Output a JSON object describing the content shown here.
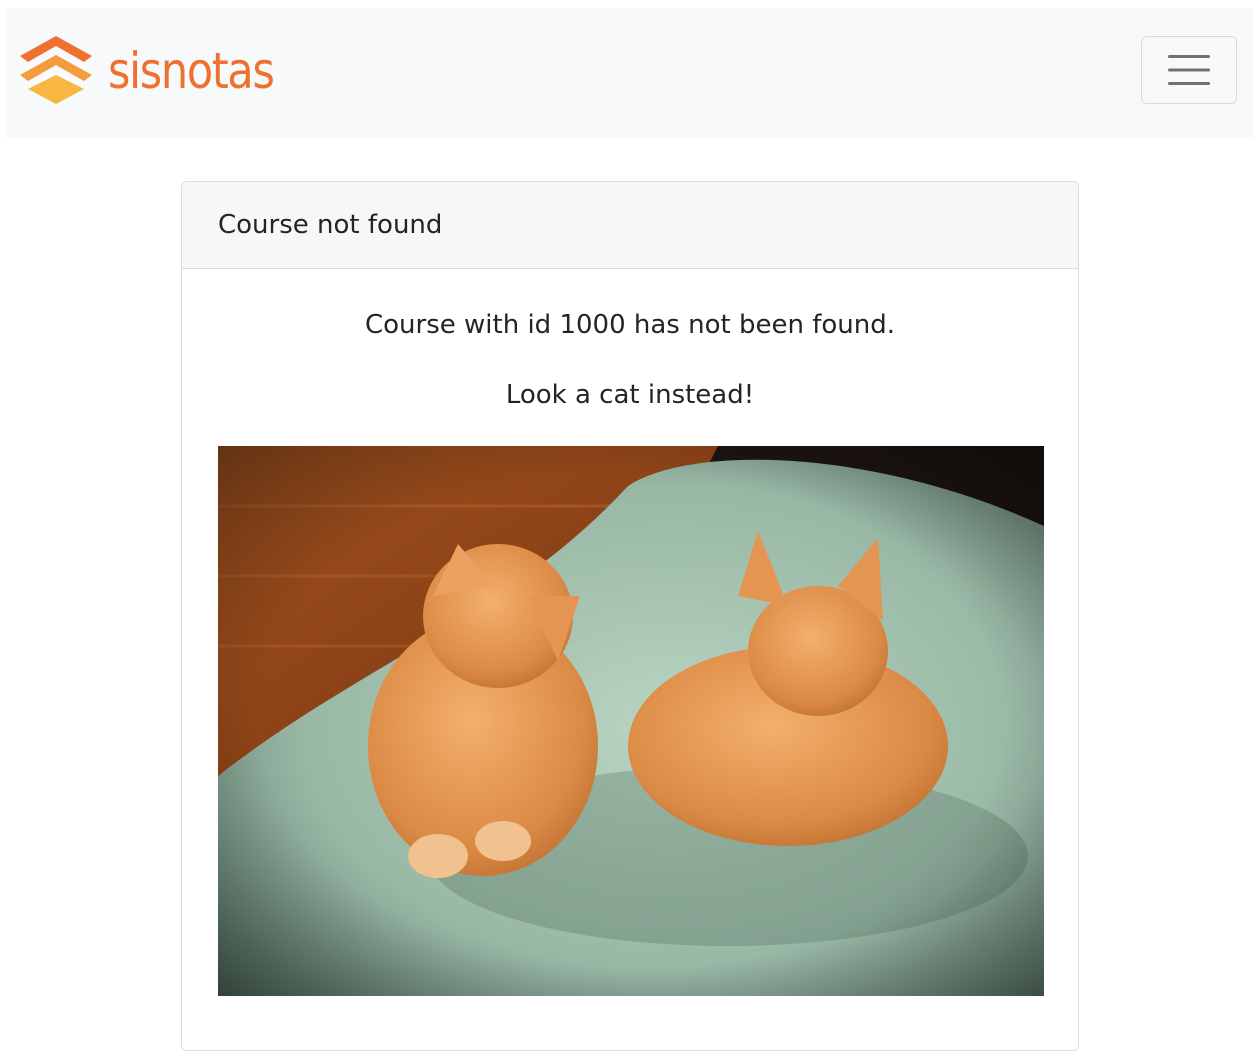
{
  "navbar": {
    "brand_name": "sisnotas",
    "brand_color": "#ee7130",
    "logo_icon": "layered-chevrons-logo",
    "toggle_icon": "hamburger-menu-icon"
  },
  "card": {
    "header_title": "Course not found",
    "message": "Course with id 1000 has not been found.",
    "cat_caption": "Look a cat instead!"
  }
}
